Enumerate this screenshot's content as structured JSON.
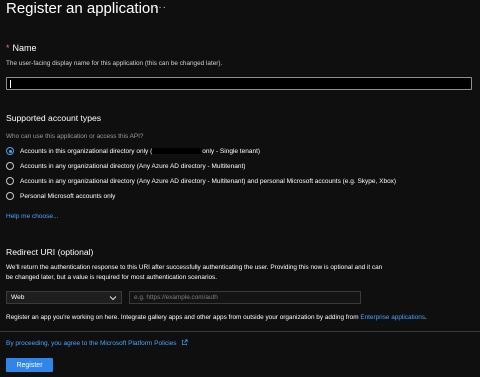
{
  "header": {
    "title": "Register an application",
    "more": "···"
  },
  "name_section": {
    "required_mark": "*",
    "label": "Name",
    "description": "The user-facing display name for this application (this can be changed later).",
    "value": ""
  },
  "account_types": {
    "heading": "Supported account types",
    "question": "Who can use this application or access this API?",
    "options": [
      {
        "label_before": "Accounts in this organizational directory only (",
        "label_after": "only - Single tenant)",
        "selected": true
      },
      {
        "label": "Accounts in any organizational directory (Any Azure AD directory - Multitenant)",
        "selected": false
      },
      {
        "label": "Accounts in any organizational directory (Any Azure AD directory - Multitenant) and personal Microsoft accounts (e.g. Skype, Xbox)",
        "selected": false
      },
      {
        "label": "Personal Microsoft accounts only",
        "selected": false
      }
    ],
    "help_link": "Help me choose..."
  },
  "redirect": {
    "heading": "Redirect URI (optional)",
    "description_1": "We'll return the authentication response to this URI after successfully authenticating the user. Providing this now is optional and it can",
    "description_2": "be changed later, but a value is required for most authentication scenarios.",
    "platform_value": "Web",
    "uri_placeholder": "e.g. https://example.com/auth"
  },
  "gallery_note": {
    "text": "Register an app you're working on here. Integrate gallery apps and other apps from outside your organization by adding from ",
    "link": "Enterprise applications",
    "end": "."
  },
  "policy": {
    "link": "By proceeding, you agree to the Microsoft Platform Policies"
  },
  "footer": {
    "register_label": "Register"
  },
  "colors": {
    "accent": "#2f86e8",
    "link": "#4da3ff",
    "required": "#f1707b",
    "background": "#0f0f0f"
  },
  "icons": {
    "more": "ellipsis-icon",
    "dropdown": "chevron-down-icon",
    "external": "external-link-icon"
  }
}
